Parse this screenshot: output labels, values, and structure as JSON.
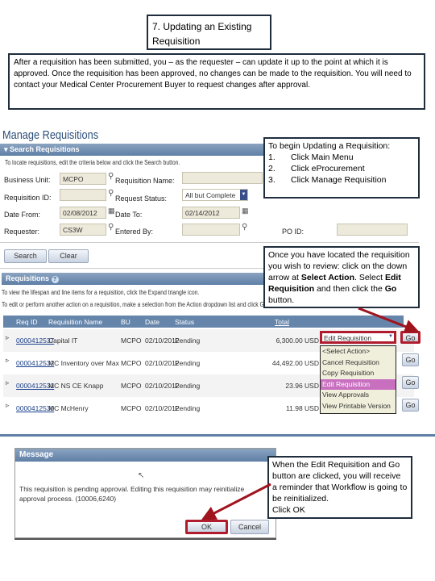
{
  "title": "7. Updating an Existing Requisition",
  "intro": "After a requisition has been submitted, you – as the requester – can update it up to the point at which it is approved.  Once the requisition has been approved, no changes can be made to the requisition. You will need to contact your Medical Center Procurement Buyer to request changes after approval.",
  "callout1": {
    "heading": "To begin Updating a Requisition:",
    "steps": [
      "1.",
      "2.",
      "3."
    ],
    "step_texts": [
      "Click Main Menu",
      "Click eProcurement",
      "Click Manage Requisition"
    ]
  },
  "callout2": {
    "t1": "Once you have located the requisition you wish to review: click on the down arrow at ",
    "b1": "Select Action",
    "t2": ". Select ",
    "b2": "Edit Requisition",
    "t3": " and then click the ",
    "b3": "Go",
    "t4": " button."
  },
  "callout3": {
    "text": "When the Edit Requisition and Go button are clicked, you will receive a reminder that Workflow is going to be reinitialized.",
    "action": "Click OK"
  },
  "page_title": "Manage Requisitions",
  "search": {
    "header": "Search Requisitions",
    "hint": "To locate requisitions, edit the criteria below and click the Search button.",
    "labels": {
      "bu": "Business Unit:",
      "reqid": "Requisition ID:",
      "from": "Date From:",
      "requester": "Requester:",
      "name": "Requisition Name:",
      "status": "Request Status:",
      "to": "Date To:",
      "entered": "Entered By:",
      "po": "PO ID:"
    },
    "values": {
      "bu": "MCPO",
      "reqid": "",
      "from": "02/08/2012",
      "requester": "CS3W",
      "name": "",
      "status": "All but Complete",
      "to": "02/14/2012",
      "entered": "",
      "po": ""
    },
    "search_btn": "Search",
    "clear_btn": "Clear"
  },
  "requisitions": {
    "header": "Requisitions",
    "hint1": "To view the lifespan and line items for a requisition, click the Expand triangle icon.",
    "hint2": "To edit or perform another action on a requisition, make a selection from the Action dropdown list and click Go.",
    "columns": [
      "Req ID",
      "Requisition Name",
      "BU",
      "Date",
      "Status",
      "Total"
    ],
    "rows": [
      {
        "id": "0000412537",
        "name": "Capital IT",
        "bu": "MCPO",
        "date": "02/10/2012",
        "status": "Pending",
        "total": "6,300.00 USD"
      },
      {
        "id": "0000412532",
        "name": "MC Inventory over Max",
        "bu": "MCPO",
        "date": "02/10/2012",
        "status": "Pending",
        "total": "44,492.00 USD"
      },
      {
        "id": "0000412531",
        "name": "MC NS CE Knapp",
        "bu": "MCPO",
        "date": "02/10/2012",
        "status": "Pending",
        "total": "23.96 USD"
      },
      {
        "id": "0000412530",
        "name": "MC McHenry",
        "bu": "MCPO",
        "date": "02/10/2012",
        "status": "Pending",
        "total": "11.98 USD"
      }
    ],
    "action_value": "Edit Requisition",
    "action_options": [
      "<Select Action>",
      "Cancel Requisition",
      "Copy Requisition",
      "Edit Requisition",
      "View Approvals",
      "View Printable Version"
    ],
    "go": "Go"
  },
  "dialog": {
    "title": "Message",
    "text": "This requisition is pending approval.  Editing this requisition may reinitialize approval process. (10006,6240)",
    "ok": "OK",
    "cancel": "Cancel"
  },
  "colors": {
    "highlight": "#b01c2e",
    "arrow": "#a0141e",
    "header": "#6685ab",
    "selected_option": "#c86fbf"
  }
}
